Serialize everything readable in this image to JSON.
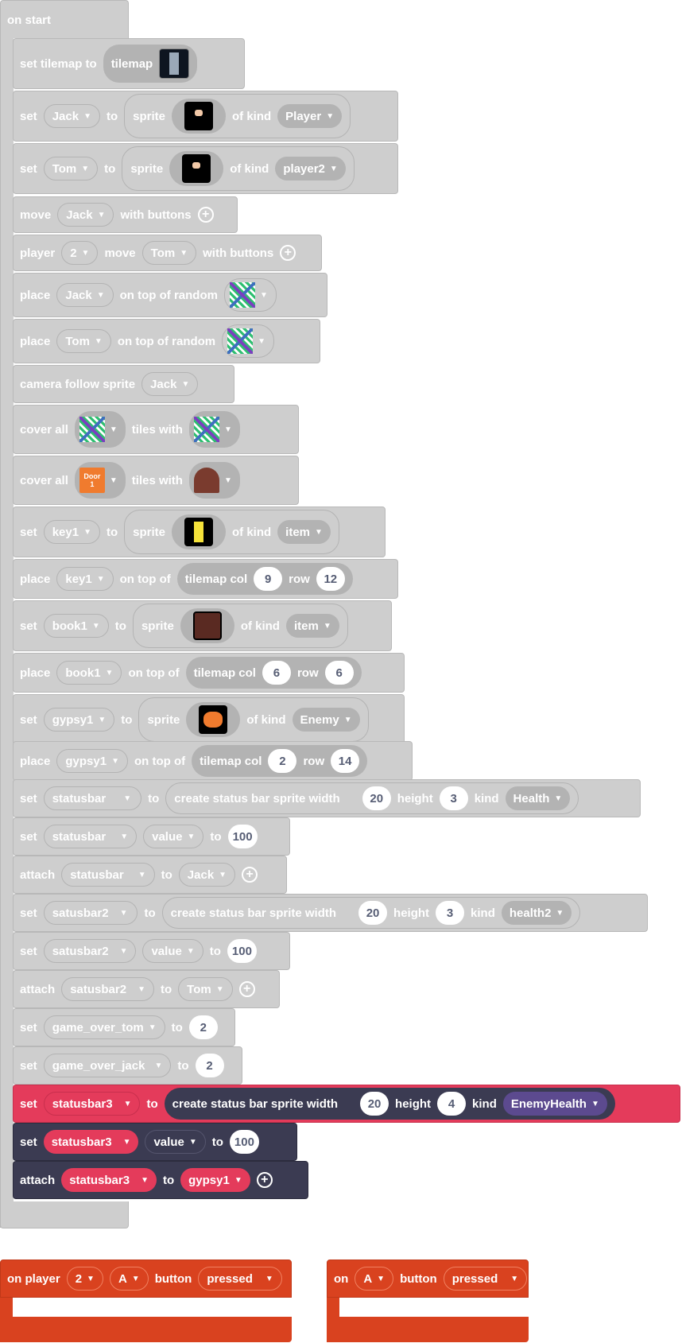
{
  "on_start": {
    "label": "on start"
  },
  "blocks": {
    "b1": {
      "set_tilemap": "set tilemap to",
      "tilemap": "tilemap"
    },
    "b2": {
      "set": "set",
      "var": "Jack",
      "to": "to",
      "sprite": "sprite",
      "of_kind": "of kind",
      "kind": "Player"
    },
    "b3": {
      "set": "set",
      "var": "Tom",
      "to": "to",
      "sprite": "sprite",
      "of_kind": "of kind",
      "kind": "player2"
    },
    "b4": {
      "move": "move",
      "var": "Jack",
      "with_buttons": "with buttons"
    },
    "b5": {
      "player": "player",
      "num": "2",
      "move": "move",
      "var": "Tom",
      "with_buttons": "with buttons"
    },
    "b6": {
      "place": "place",
      "var": "Jack",
      "on_top": "on top of random"
    },
    "b7": {
      "place": "place",
      "var": "Tom",
      "on_top": "on top of random"
    },
    "b8": {
      "camera": "camera follow sprite",
      "var": "Jack"
    },
    "b9": {
      "cover_all": "cover all",
      "tiles_with": "tiles with"
    },
    "b10": {
      "cover_all": "cover all",
      "tiles_with": "tiles with",
      "door_text_1": "Door",
      "door_text_2": "1"
    },
    "b11": {
      "set": "set",
      "var": "key1",
      "to": "to",
      "sprite": "sprite",
      "of_kind": "of kind",
      "kind": "item"
    },
    "b12": {
      "place": "place",
      "var": "key1",
      "on_top": "on top of",
      "tilemap_col": "tilemap col",
      "col": "9",
      "row_label": "row",
      "row": "12"
    },
    "b13": {
      "set": "set",
      "var": "book1",
      "to": "to",
      "sprite": "sprite",
      "of_kind": "of kind",
      "kind": "item"
    },
    "b14": {
      "place": "place",
      "var": "book1",
      "on_top": "on top of",
      "tilemap_col": "tilemap col",
      "col": "6",
      "row_label": "row",
      "row": "6"
    },
    "b15": {
      "set": "set",
      "var": "gypsy1",
      "to": "to",
      "sprite": "sprite",
      "of_kind": "of kind",
      "kind": "Enemy"
    },
    "b16": {
      "place": "place",
      "var": "gypsy1",
      "on_top": "on top of",
      "tilemap_col": "tilemap col",
      "col": "2",
      "row_label": "row",
      "row": "14"
    },
    "b17": {
      "set": "set",
      "var": "statusbar",
      "to": "to",
      "create": "create status bar sprite width",
      "width": "20",
      "height_label": "height",
      "height": "3",
      "kind_label": "kind",
      "kind": "Health"
    },
    "b18": {
      "set": "set",
      "var": "statusbar",
      "prop": "value",
      "to": "to",
      "val": "100"
    },
    "b19": {
      "attach": "attach",
      "var": "statusbar",
      "to": "to",
      "target": "Jack"
    },
    "b20": {
      "set": "set",
      "var": "satusbar2",
      "to": "to",
      "create": "create status bar sprite width",
      "width": "20",
      "height_label": "height",
      "height": "3",
      "kind_label": "kind",
      "kind": "health2"
    },
    "b21": {
      "set": "set",
      "var": "satusbar2",
      "prop": "value",
      "to": "to",
      "val": "100"
    },
    "b22": {
      "attach": "attach",
      "var": "satusbar2",
      "to": "to",
      "target": "Tom"
    },
    "b23": {
      "set": "set",
      "var": "game_over_tom",
      "to": "to",
      "val": "2"
    },
    "b24": {
      "set": "set",
      "var": "game_over_jack",
      "to": "to",
      "val": "2"
    },
    "b25": {
      "set": "set",
      "var": "statusbar3",
      "to": "to",
      "create": "create status bar sprite width",
      "width": "20",
      "height_label": "height",
      "height": "4",
      "kind_label": "kind",
      "kind": "EnemyHealth"
    },
    "b26": {
      "set": "set",
      "var": "statusbar3",
      "prop": "value",
      "to": "to",
      "val": "100"
    },
    "b27": {
      "attach": "attach",
      "var": "statusbar3",
      "to": "to",
      "target": "gypsy1"
    }
  },
  "events": {
    "e1": {
      "on_player": "on player",
      "player": "2",
      "button": "A",
      "button_label": "button",
      "state": "pressed"
    },
    "e2": {
      "on": "on",
      "button": "A",
      "button_label": "button",
      "state": "pressed"
    }
  },
  "colors": {
    "loops_gray": "#cecece",
    "statusbar_dark": "#3b3b52",
    "sprite_red": "#e43b5b",
    "controller_orange": "#d9421f",
    "kind_purple": "#5c4a8f"
  },
  "icons": [
    "add-icon",
    "dropdown-arrow-icon"
  ]
}
